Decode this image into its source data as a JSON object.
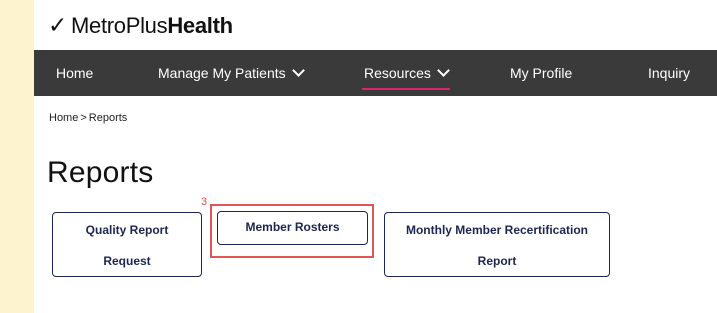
{
  "brand": {
    "light": "MetroPlus",
    "bold": "Health",
    "check": "✓"
  },
  "nav": {
    "items": [
      {
        "label": "Home"
      },
      {
        "label": "Manage My Patients"
      },
      {
        "label": "Resources"
      },
      {
        "label": "My Profile"
      },
      {
        "label": "Inquiry"
      }
    ]
  },
  "breadcrumb": {
    "home": "Home",
    "sep": ">",
    "current": "Reports"
  },
  "page_title": "Reports",
  "report_buttons": {
    "quality_line1": "Quality Report",
    "quality_line2": "Request",
    "rosters": "Member Rosters",
    "recert_line1": "Monthly Member Recertification",
    "recert_line2": "Report"
  },
  "annotation": {
    "marker": "3",
    "color": "#e05555"
  },
  "colors": {
    "nav_bg": "#3a3a3a",
    "accent": "#d6246e",
    "button_border": "#1d2552",
    "outer_bg": "#fdf3cf"
  }
}
